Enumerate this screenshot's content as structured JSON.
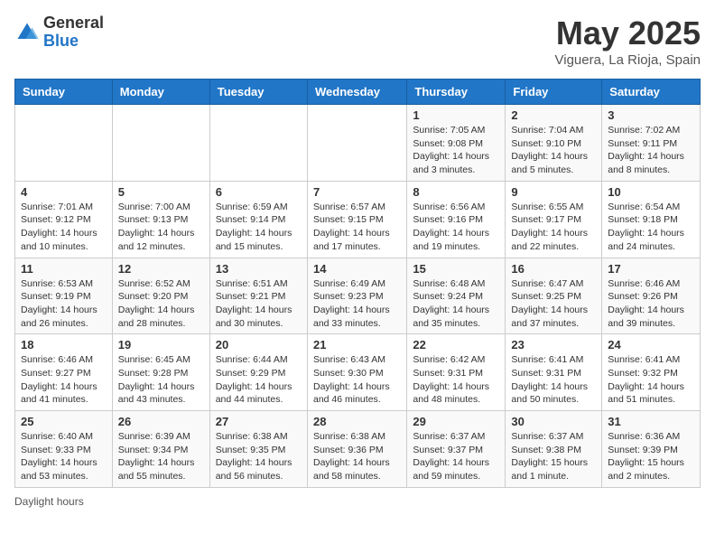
{
  "header": {
    "logo_general": "General",
    "logo_blue": "Blue",
    "title": "May 2025",
    "location": "Viguera, La Rioja, Spain"
  },
  "days_of_week": [
    "Sunday",
    "Monday",
    "Tuesday",
    "Wednesday",
    "Thursday",
    "Friday",
    "Saturday"
  ],
  "weeks": [
    [
      {
        "day": "",
        "info": ""
      },
      {
        "day": "",
        "info": ""
      },
      {
        "day": "",
        "info": ""
      },
      {
        "day": "",
        "info": ""
      },
      {
        "day": "1",
        "info": "Sunrise: 7:05 AM\nSunset: 9:08 PM\nDaylight: 14 hours and 3 minutes."
      },
      {
        "day": "2",
        "info": "Sunrise: 7:04 AM\nSunset: 9:10 PM\nDaylight: 14 hours and 5 minutes."
      },
      {
        "day": "3",
        "info": "Sunrise: 7:02 AM\nSunset: 9:11 PM\nDaylight: 14 hours and 8 minutes."
      }
    ],
    [
      {
        "day": "4",
        "info": "Sunrise: 7:01 AM\nSunset: 9:12 PM\nDaylight: 14 hours and 10 minutes."
      },
      {
        "day": "5",
        "info": "Sunrise: 7:00 AM\nSunset: 9:13 PM\nDaylight: 14 hours and 12 minutes."
      },
      {
        "day": "6",
        "info": "Sunrise: 6:59 AM\nSunset: 9:14 PM\nDaylight: 14 hours and 15 minutes."
      },
      {
        "day": "7",
        "info": "Sunrise: 6:57 AM\nSunset: 9:15 PM\nDaylight: 14 hours and 17 minutes."
      },
      {
        "day": "8",
        "info": "Sunrise: 6:56 AM\nSunset: 9:16 PM\nDaylight: 14 hours and 19 minutes."
      },
      {
        "day": "9",
        "info": "Sunrise: 6:55 AM\nSunset: 9:17 PM\nDaylight: 14 hours and 22 minutes."
      },
      {
        "day": "10",
        "info": "Sunrise: 6:54 AM\nSunset: 9:18 PM\nDaylight: 14 hours and 24 minutes."
      }
    ],
    [
      {
        "day": "11",
        "info": "Sunrise: 6:53 AM\nSunset: 9:19 PM\nDaylight: 14 hours and 26 minutes."
      },
      {
        "day": "12",
        "info": "Sunrise: 6:52 AM\nSunset: 9:20 PM\nDaylight: 14 hours and 28 minutes."
      },
      {
        "day": "13",
        "info": "Sunrise: 6:51 AM\nSunset: 9:21 PM\nDaylight: 14 hours and 30 minutes."
      },
      {
        "day": "14",
        "info": "Sunrise: 6:49 AM\nSunset: 9:23 PM\nDaylight: 14 hours and 33 minutes."
      },
      {
        "day": "15",
        "info": "Sunrise: 6:48 AM\nSunset: 9:24 PM\nDaylight: 14 hours and 35 minutes."
      },
      {
        "day": "16",
        "info": "Sunrise: 6:47 AM\nSunset: 9:25 PM\nDaylight: 14 hours and 37 minutes."
      },
      {
        "day": "17",
        "info": "Sunrise: 6:46 AM\nSunset: 9:26 PM\nDaylight: 14 hours and 39 minutes."
      }
    ],
    [
      {
        "day": "18",
        "info": "Sunrise: 6:46 AM\nSunset: 9:27 PM\nDaylight: 14 hours and 41 minutes."
      },
      {
        "day": "19",
        "info": "Sunrise: 6:45 AM\nSunset: 9:28 PM\nDaylight: 14 hours and 43 minutes."
      },
      {
        "day": "20",
        "info": "Sunrise: 6:44 AM\nSunset: 9:29 PM\nDaylight: 14 hours and 44 minutes."
      },
      {
        "day": "21",
        "info": "Sunrise: 6:43 AM\nSunset: 9:30 PM\nDaylight: 14 hours and 46 minutes."
      },
      {
        "day": "22",
        "info": "Sunrise: 6:42 AM\nSunset: 9:31 PM\nDaylight: 14 hours and 48 minutes."
      },
      {
        "day": "23",
        "info": "Sunrise: 6:41 AM\nSunset: 9:31 PM\nDaylight: 14 hours and 50 minutes."
      },
      {
        "day": "24",
        "info": "Sunrise: 6:41 AM\nSunset: 9:32 PM\nDaylight: 14 hours and 51 minutes."
      }
    ],
    [
      {
        "day": "25",
        "info": "Sunrise: 6:40 AM\nSunset: 9:33 PM\nDaylight: 14 hours and 53 minutes."
      },
      {
        "day": "26",
        "info": "Sunrise: 6:39 AM\nSunset: 9:34 PM\nDaylight: 14 hours and 55 minutes."
      },
      {
        "day": "27",
        "info": "Sunrise: 6:38 AM\nSunset: 9:35 PM\nDaylight: 14 hours and 56 minutes."
      },
      {
        "day": "28",
        "info": "Sunrise: 6:38 AM\nSunset: 9:36 PM\nDaylight: 14 hours and 58 minutes."
      },
      {
        "day": "29",
        "info": "Sunrise: 6:37 AM\nSunset: 9:37 PM\nDaylight: 14 hours and 59 minutes."
      },
      {
        "day": "30",
        "info": "Sunrise: 6:37 AM\nSunset: 9:38 PM\nDaylight: 15 hours and 1 minute."
      },
      {
        "day": "31",
        "info": "Sunrise: 6:36 AM\nSunset: 9:39 PM\nDaylight: 15 hours and 2 minutes."
      }
    ]
  ],
  "footer": {
    "daylight_hours_label": "Daylight hours"
  }
}
